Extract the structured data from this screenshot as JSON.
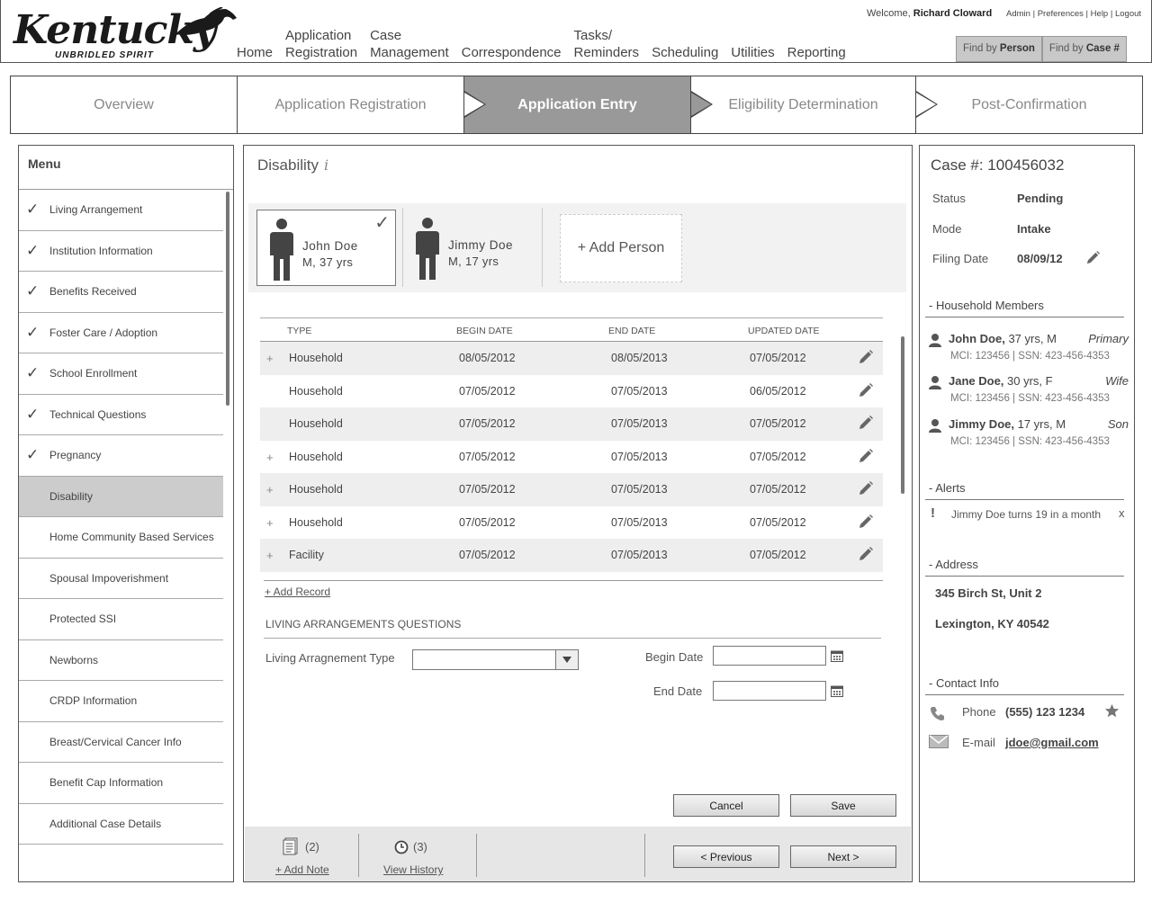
{
  "header": {
    "logo_word": "Kentucky",
    "logo_tag": "UNBRIDLED SPIRIT",
    "nav": [
      "Home",
      "Application\nRegistration",
      "Case\nManagement",
      "Correspondence",
      "Tasks/\nReminders",
      "Scheduling",
      "Utilities",
      "Reporting"
    ],
    "welcome_prefix": "Welcome, ",
    "welcome_user": "Richard Cloward",
    "links": [
      "Admin",
      "Preferences",
      "Help",
      "Logout"
    ],
    "find_person_prefix": "Find by ",
    "find_person_key": "Person",
    "find_case_prefix": "Find by ",
    "find_case_key": "Case #"
  },
  "steps": [
    "Overview",
    "Application Registration",
    "Application Entry",
    "Eligibility Determination",
    "Post-Confirmation"
  ],
  "menu": {
    "title": "Menu",
    "check": "✓",
    "items": [
      {
        "label": "Living Arrangement",
        "done": true
      },
      {
        "label": "Institution Information",
        "done": true
      },
      {
        "label": "Benefits Received",
        "done": true
      },
      {
        "label": "Foster Care / Adoption",
        "done": true
      },
      {
        "label": "School Enrollment",
        "done": true
      },
      {
        "label": "Technical Questions",
        "done": true
      },
      {
        "label": "Pregnancy",
        "done": true
      },
      {
        "label": "Disability",
        "done": false,
        "active": true
      },
      {
        "label": "Home Community Based Services",
        "done": false
      },
      {
        "label": "Spousal Impoverishment",
        "done": false
      },
      {
        "label": "Protected SSI",
        "done": false
      },
      {
        "label": "Newborns",
        "done": false
      },
      {
        "label": "CRDP Information",
        "done": false
      },
      {
        "label": "Breast/Cervical Cancer Info",
        "done": false
      },
      {
        "label": "Benefit Cap Information",
        "done": false
      },
      {
        "label": "Additional Case Details",
        "done": false
      }
    ]
  },
  "main": {
    "title": "Disability",
    "info_icon": "i",
    "persons": [
      {
        "name": "John Doe",
        "meta": "M, 37 yrs",
        "selected": true
      },
      {
        "name": "Jimmy Doe",
        "meta": "M, 17 yrs",
        "selected": false
      }
    ],
    "person_check": "✓",
    "add_person": "+ Add Person",
    "columns": [
      "TYPE",
      "BEGIN DATE",
      "END DATE",
      "UPDATED DATE"
    ],
    "rows": [
      {
        "plus": "+",
        "type": "Household",
        "begin": "08/05/2012",
        "end": "08/05/2013",
        "updated": "07/05/2012"
      },
      {
        "plus": "",
        "type": "Household",
        "begin": "07/05/2012",
        "end": "07/05/2013",
        "updated": "06/05/2012"
      },
      {
        "plus": "",
        "type": "Household",
        "begin": "07/05/2012",
        "end": "07/05/2013",
        "updated": "07/05/2012"
      },
      {
        "plus": "+",
        "type": "Household",
        "begin": "07/05/2012",
        "end": "07/05/2013",
        "updated": "07/05/2012"
      },
      {
        "plus": "+",
        "type": "Household",
        "begin": "07/05/2012",
        "end": "07/05/2013",
        "updated": "07/05/2012"
      },
      {
        "plus": "+",
        "type": "Household",
        "begin": "07/05/2012",
        "end": "07/05/2013",
        "updated": "07/05/2012"
      },
      {
        "plus": "+",
        "type": "Facility",
        "begin": "07/05/2012",
        "end": "07/05/2013",
        "updated": "07/05/2012"
      }
    ],
    "add_record": "+ Add Record",
    "questions_heading": "LIVING ARRANGEMENTS QUESTIONS",
    "arrangement_type_label": "Living Arragnement Type",
    "arrangement_type_value": "",
    "begin_date_label": "Begin Date",
    "begin_date_value": "",
    "end_date_label": "End Date",
    "end_date_value": "",
    "cancel": "Cancel",
    "save": "Save",
    "notes_count": "(2)",
    "add_note": "+ Add Note",
    "history_count": "(3)",
    "view_history": "View History",
    "previous": "< Previous",
    "next": "Next >"
  },
  "case": {
    "title": "Case #: 100456032",
    "status_label": "Status",
    "status": "Pending",
    "mode_label": "Mode",
    "mode": "Intake",
    "filing_label": "Filing Date",
    "filing": "08/09/12",
    "household_heading": "- Household Members",
    "members": [
      {
        "name": "John Doe,",
        "meta": " 37 yrs,   M",
        "role": "Primary",
        "ids": "MCI: 123456 | SSN: 423-456-4353"
      },
      {
        "name": "Jane Doe,",
        "meta": " 30 yrs,   F",
        "role": "Wife",
        "ids": "MCI: 123456 | SSN: 423-456-4353"
      },
      {
        "name": "Jimmy Doe,",
        "meta": " 17 yrs,  M",
        "role": "Son",
        "ids": "MCI: 123456 | SSN: 423-456-4353"
      }
    ],
    "alerts_heading": "- Alerts",
    "alert_mark": "!",
    "alert": "Jimmy Doe turns 19 in a month",
    "alert_close": "x",
    "address_heading": "- Address",
    "address_line1": "345 Birch St, Unit 2",
    "address_line2": "Lexington, KY 40542",
    "contact_heading": "- Contact Info",
    "phone_label": "Phone",
    "phone": "(555) 123 1234",
    "email_label": "E-mail",
    "email": "jdoe@gmail.com"
  },
  "colors": {
    "active_step": "#999999",
    "menu_active": "#cccccc",
    "row_shade": "#eeeeee"
  }
}
